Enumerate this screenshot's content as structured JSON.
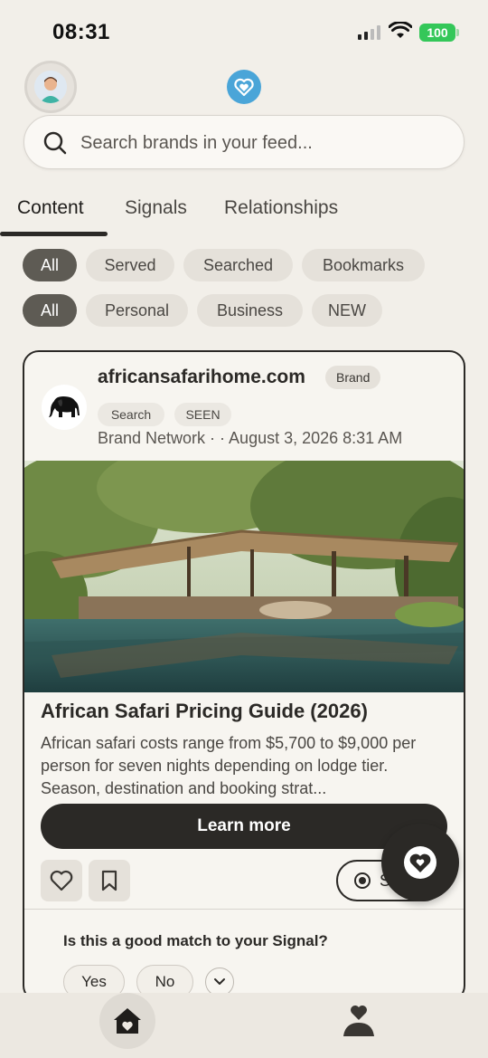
{
  "status": {
    "time": "08:31",
    "battery": "100"
  },
  "search": {
    "placeholder": "Search brands in your feed..."
  },
  "tabs": [
    {
      "label": "Content",
      "active": true
    },
    {
      "label": "Signals"
    },
    {
      "label": "Relationships"
    }
  ],
  "filters_source": [
    "All",
    "Served",
    "Searched",
    "Bookmarks"
  ],
  "filters_type": [
    "All",
    "Personal",
    "Business",
    "NEW"
  ],
  "card": {
    "brand": "africansafarihome.com",
    "badge": "Brand",
    "chips": [
      "Search",
      "SEEN"
    ],
    "meta": "Brand Network · · August 3, 2026 8:31 AM",
    "title": "African Safari Pricing Guide (2026)",
    "description": "African safari costs range from $5,700 to $9,000 per person for seven nights depending on lodge tier. Season, destination and booking strat...",
    "cta": "Learn more",
    "signal_label": "S",
    "question": "Is this a good match to your Signal?",
    "answers": [
      "Yes",
      "No"
    ]
  },
  "icons": {
    "search": "search-icon",
    "like": "heart-icon",
    "bookmark": "bookmark-icon",
    "fab": "heart-logo-icon",
    "home": "home-icon",
    "profile": "profile-heart-icon"
  },
  "colors": {
    "accent": "#2b2926",
    "battery": "#34c759",
    "logo": "#4aa5d8",
    "background": "#f2efe9"
  }
}
